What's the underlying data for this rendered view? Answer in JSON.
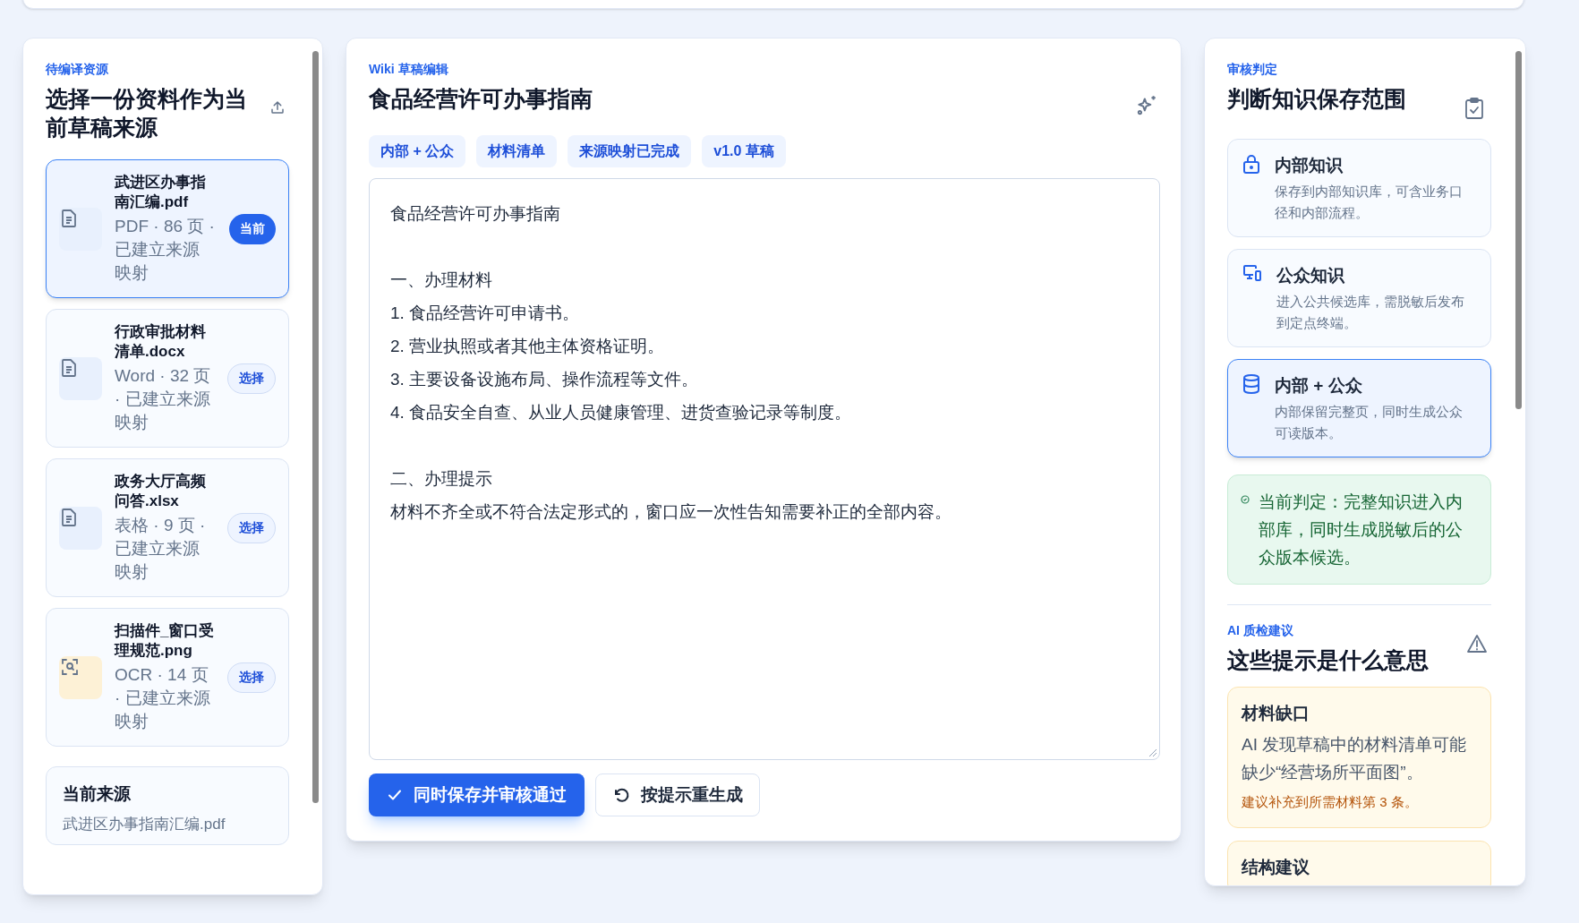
{
  "sources": {
    "eyebrow": "待编译资源",
    "title": "选择一份资料作为当前草稿来源",
    "items": [
      {
        "kind": "document",
        "name": "武进区办事指南汇编.pdf",
        "meta": "PDF · 86 页 · 已建立来源映射",
        "action": "当前",
        "selected": true
      },
      {
        "kind": "document",
        "name": "行政审批材料清单.docx",
        "meta": "Word · 32 页 · 已建立来源映射",
        "action": "选择",
        "selected": false
      },
      {
        "kind": "document",
        "name": "政务大厅高频问答.xlsx",
        "meta": "表格 · 9 页 · 已建立来源映射",
        "action": "选择",
        "selected": false
      },
      {
        "kind": "scan",
        "name": "扫描件_窗口受理规范.png",
        "meta": "OCR · 14 页 · 已建立来源映射",
        "action": "选择",
        "selected": false
      }
    ],
    "current": {
      "label": "当前来源",
      "value": "武进区办事指南汇编.pdf"
    }
  },
  "editor": {
    "eyebrow": "Wiki 草稿编辑",
    "title": "食品经营许可办事指南",
    "tags": [
      "内部 + 公众",
      "材料清单",
      "来源映射已完成",
      "v1.0 草稿"
    ],
    "blocks": [
      [
        "食品经营许可办事指南"
      ],
      [
        "一、办理材料",
        "1. 食品经营许可申请书。",
        "2. 营业执照或者其他主体资格证明。",
        "3. 主要设备设施布局、操作流程等文件。",
        "4. 食品安全自查、从业人员健康管理、进货查验记录等制度。"
      ],
      [
        "二、办理提示",
        "材料不齐全或不符合法定形式的，窗口应一次性告知需要补正的全部内容。"
      ]
    ],
    "primary_button": "同时保存并审核通过",
    "secondary_button": "按提示重生成"
  },
  "review": {
    "eyebrow": "审核判定",
    "title": "判断知识保存范围",
    "options": [
      {
        "kind": "lock",
        "title": "内部知识",
        "description": "保存到内部知识库，可含业务口径和内部流程。",
        "selected": false
      },
      {
        "kind": "devices",
        "title": "公众知识",
        "description": "进入公共候选库，需脱敏后发布到定点终端。",
        "selected": false
      },
      {
        "kind": "database",
        "title": "内部 + 公众",
        "description": "内部保留完整页，同时生成公众可读版本。",
        "selected": true
      }
    ],
    "verdict": "当前判定：完整知识进入内部库，同时生成脱敏后的公众版本候选。"
  },
  "suggestions": {
    "eyebrow": "AI 质检建议",
    "title": "这些提示是什么意思",
    "items": [
      {
        "title": "材料缺口",
        "body": "AI 发现草稿中的材料清单可能缺少“经营场所平面图”。",
        "tip": "建议补充到所需材料第 3 条。"
      },
      {
        "title": "结构建议"
      }
    ]
  }
}
